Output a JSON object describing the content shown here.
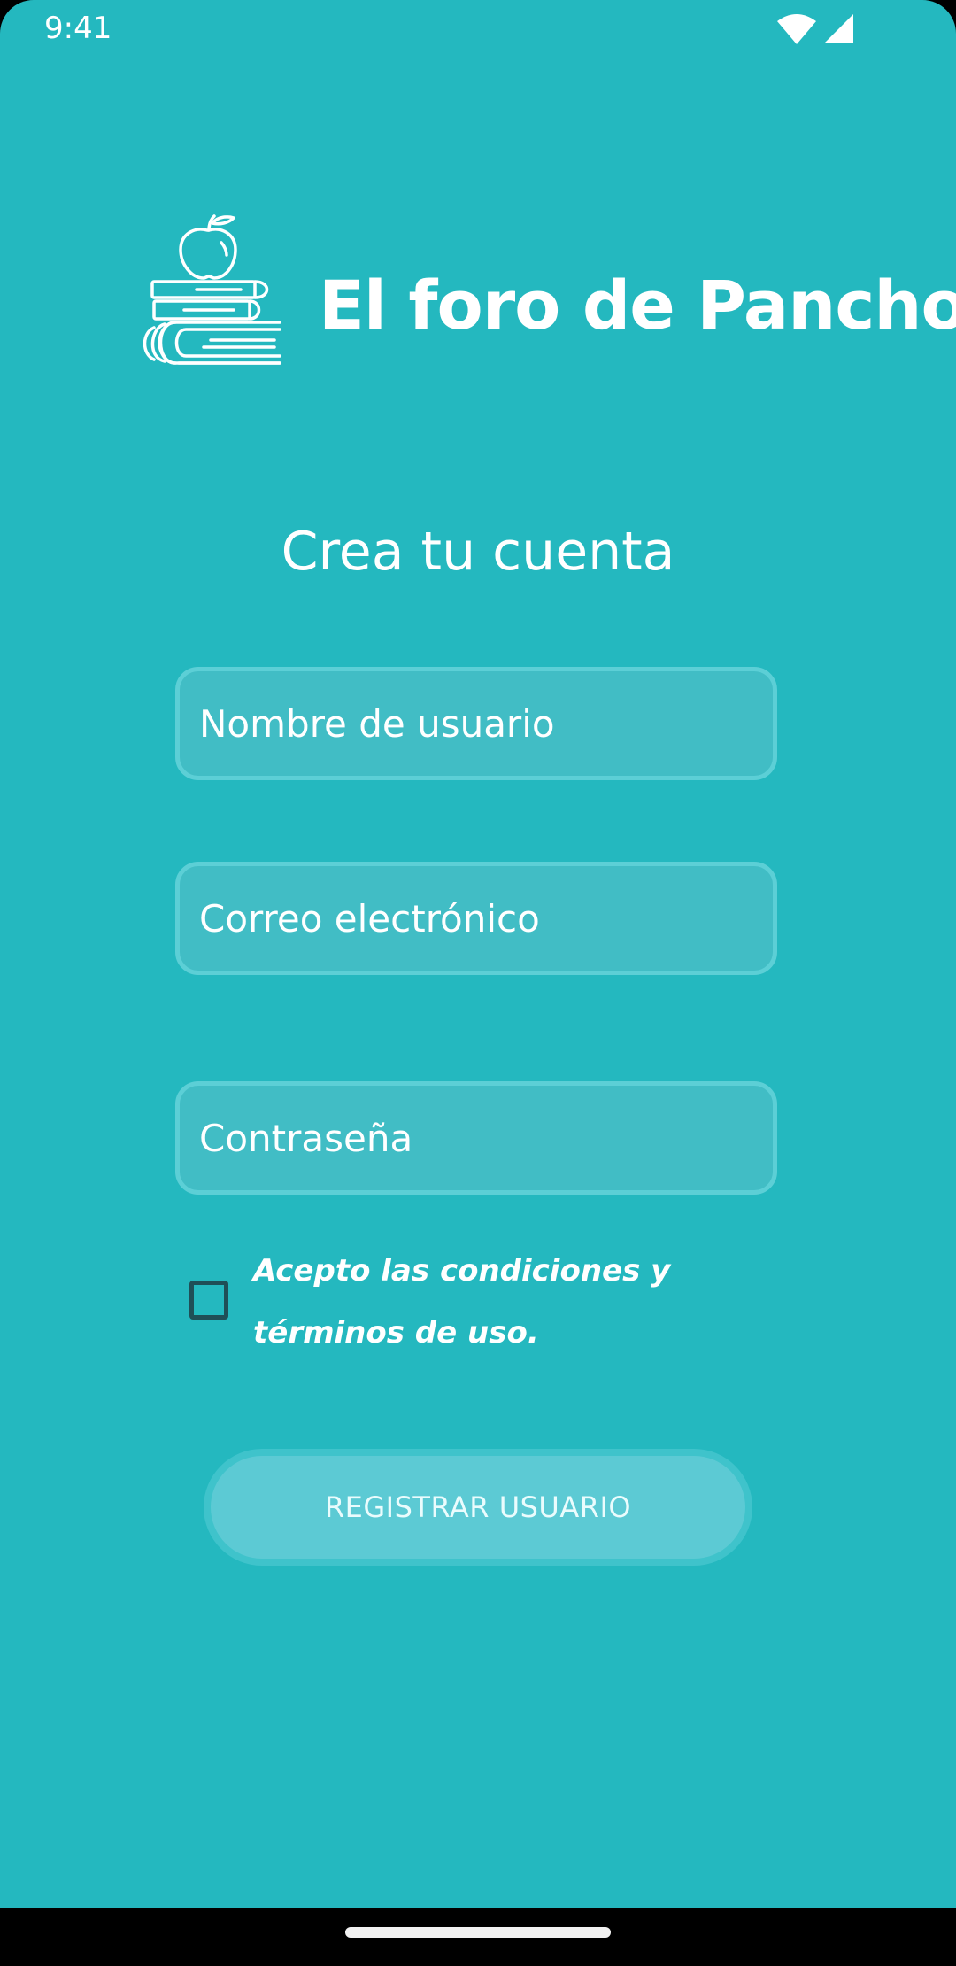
{
  "status_bar": {
    "time": "9:41",
    "icons": [
      "wifi-icon",
      "cell-signal-icon"
    ]
  },
  "brand": {
    "logo_icon": "books-apple-icon",
    "name": "El foro de Pancho"
  },
  "form": {
    "title": "Crea tu cuenta",
    "username": {
      "placeholder": "Nombre de usuario",
      "value": ""
    },
    "email": {
      "placeholder": "Correo electrónico",
      "value": ""
    },
    "password": {
      "placeholder": "Contraseña",
      "value": ""
    },
    "terms": {
      "label": "Acepto las condiciones y términos de uso.",
      "checked": false
    },
    "submit_label": "REGISTRAR USUARIO"
  },
  "colors": {
    "background": "#24b8bf",
    "field_fill": "#41bdc5",
    "field_border": "#5ccfd6",
    "button_fill": "#5ccad4",
    "checkbox_border": "#1f4f57"
  }
}
